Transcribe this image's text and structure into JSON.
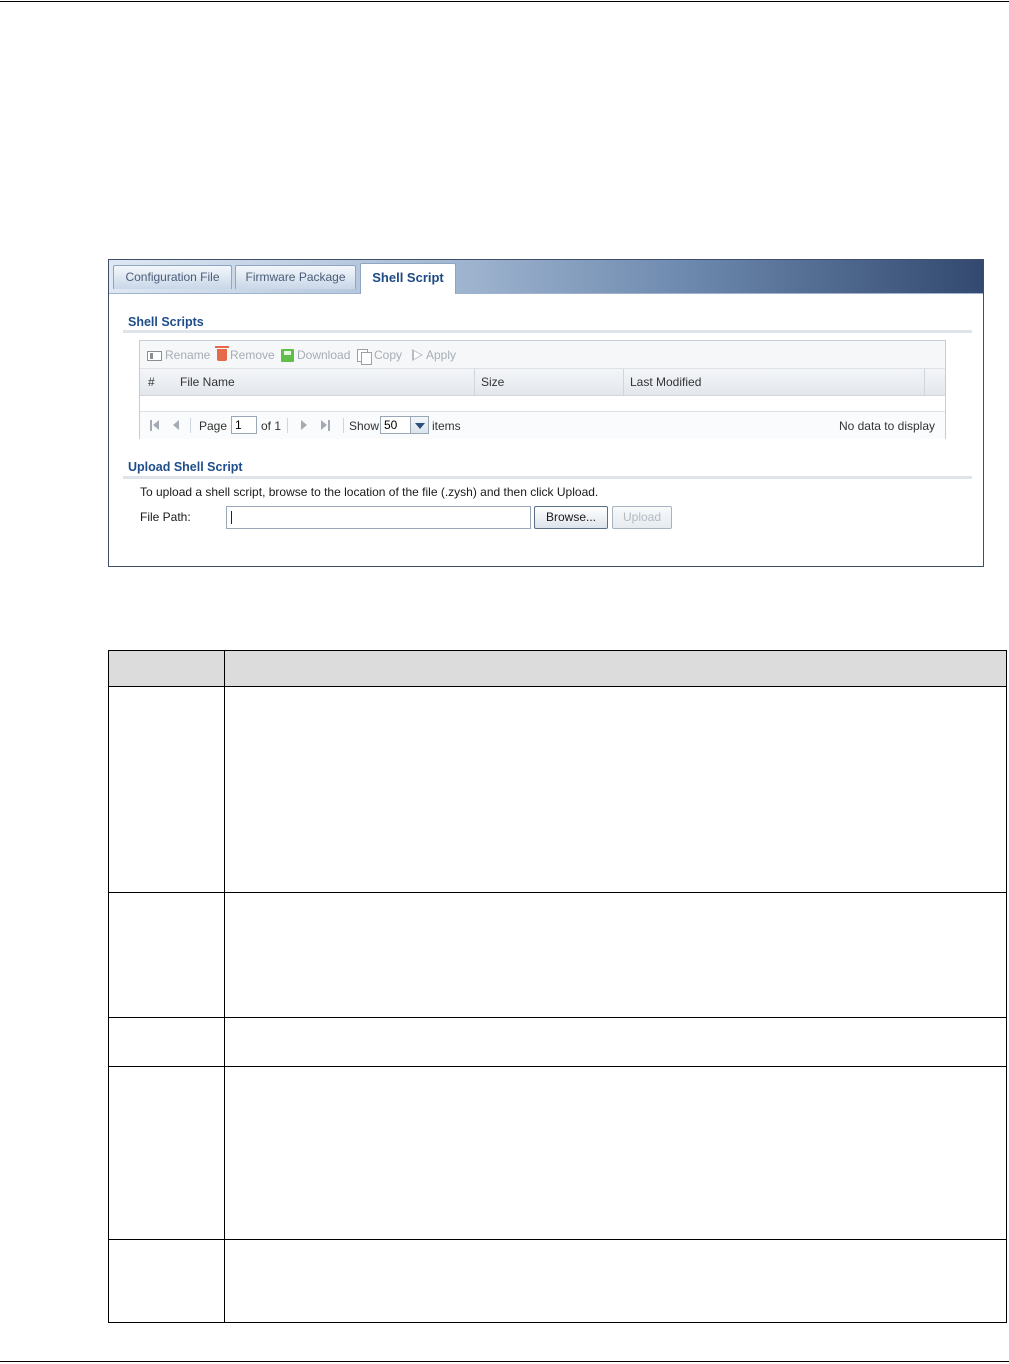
{
  "tabs": [
    {
      "label": "Configuration File",
      "active": false
    },
    {
      "label": "Firmware Package",
      "active": false
    },
    {
      "label": "Shell Script",
      "active": true
    }
  ],
  "shell_scripts": {
    "title": "Shell Scripts",
    "toolbar": {
      "rename": "Rename",
      "remove": "Remove",
      "download": "Download",
      "copy": "Copy",
      "apply": "Apply"
    },
    "columns": [
      "#",
      "File Name",
      "Size",
      "Last Modified"
    ],
    "pager": {
      "page_label": "Page",
      "page_value": "1",
      "of_label": "of 1",
      "show_label": "Show",
      "show_value": "50",
      "items_label": "items",
      "status": "No data to display"
    }
  },
  "upload": {
    "title": "Upload Shell Script",
    "description": "To upload a shell script, browse to the location of the file (.zysh) and then click Upload.",
    "file_path_label": "File Path:",
    "file_path_value": "",
    "browse_button": "Browse...",
    "upload_button": "Upload"
  },
  "colors": {
    "title_blue": "#1f4d8c",
    "tab_active_text": "#1d4a85",
    "disabled_text": "#a6adb6"
  }
}
